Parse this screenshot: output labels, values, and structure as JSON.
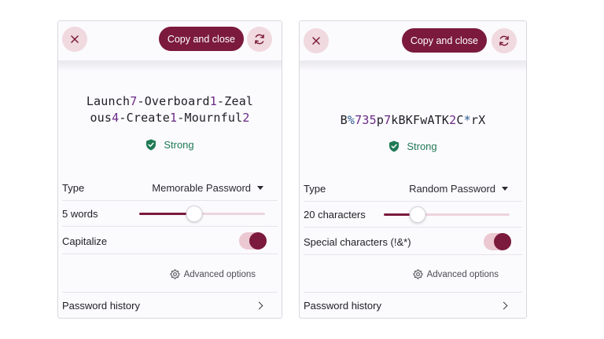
{
  "colors": {
    "accent": "#7b1a3d",
    "accent_light": "#f0d9df",
    "strong_green": "#1f7a55"
  },
  "panels": [
    {
      "copy_label": "Copy and close",
      "password_parts": [
        {
          "t": "Launch"
        },
        {
          "t": "7",
          "k": "d"
        },
        {
          "t": "-"
        },
        {
          "t": "Overboard"
        },
        {
          "t": "1",
          "k": "d"
        },
        {
          "t": "-"
        },
        {
          "t": "Zealous"
        },
        {
          "t": "4",
          "k": "d"
        },
        {
          "t": "-"
        },
        {
          "t": "Create"
        },
        {
          "t": "1",
          "k": "d"
        },
        {
          "t": "-"
        },
        {
          "t": "Mournful"
        },
        {
          "t": "2",
          "k": "d"
        }
      ],
      "strength": "Strong",
      "type_label": "Type",
      "type_value": "Memorable Password",
      "length_label": "5 words",
      "length_fraction": 0.44,
      "option_label": "Capitalize",
      "option_enabled": true,
      "advanced_label": "Advanced options",
      "history_label": "Password history"
    },
    {
      "copy_label": "Copy and close",
      "password_parts": [
        {
          "t": "B"
        },
        {
          "t": "%",
          "k": "s"
        },
        {
          "t": "735",
          "k": "d"
        },
        {
          "t": "p"
        },
        {
          "t": "7",
          "k": "d"
        },
        {
          "t": "kBKFwATK"
        },
        {
          "t": "2",
          "k": "d"
        },
        {
          "t": "C"
        },
        {
          "t": "*",
          "k": "s"
        },
        {
          "t": "rX"
        }
      ],
      "strength": "Strong",
      "type_label": "Type",
      "type_value": "Random Password",
      "length_label": "20 characters",
      "length_fraction": 0.27,
      "option_label": "Special characters (!&*)",
      "option_enabled": true,
      "advanced_label": "Advanced options",
      "history_label": "Password history"
    }
  ]
}
